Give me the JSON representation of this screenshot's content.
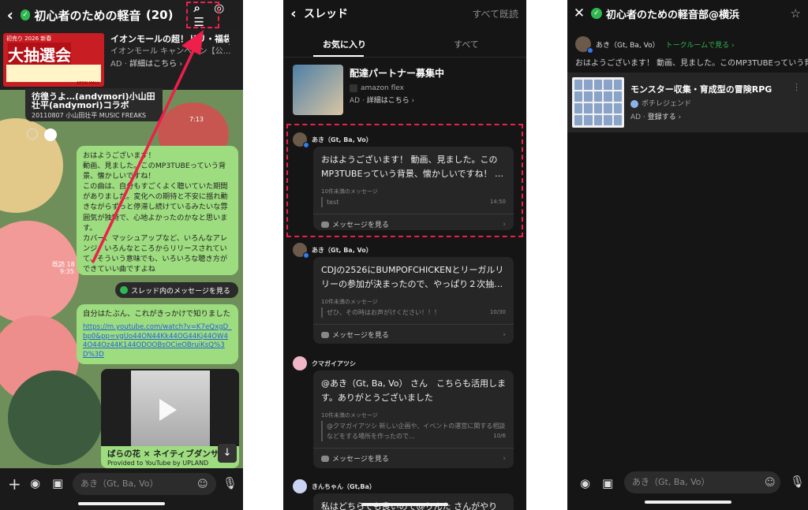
{
  "screen1": {
    "title": "初心者のための軽音",
    "count": "(20)",
    "ad": {
      "banner_top": "初売り 2026 新春",
      "banner_big": "大抽選会",
      "banner_store": "AEON MALL",
      "title": "イオンモールの超！ドリ・福袋",
      "advertiser": "イオンモール キャンペーン【公…",
      "ad_label": "AD",
      "details": "詳細はこちら"
    },
    "quote": {
      "line1": "彷徨うよ…(andymori)小山田",
      "line2": "壮平(andymori)コラボ",
      "line3": "20110807 小山田壮平 MUSIC FREAKS"
    },
    "time1": "7:13",
    "bubble1": "おはようございます！\n動画、見ました。このMP3TUBEっていう背景、懐かしいですね！\nこの曲は、自分もすごくよく聴いていた期間がありました。変化への期待と不安に揺れ動きながらずっと停滞し続けているみたいな雰囲気が独特で、心地よかったのかなと思います。\nカバー、マッシュアップなど、いろんなアレンジ、いろんなところからリリースされていて、そういう意味でも、いろいろな聴き方ができていい曲ですよね",
    "read": "既読 18",
    "time2": "9:35",
    "thread_button": "スレッド内のメッセージを見る",
    "bubble2_text": "自分はたぶん、これがきっかけで知りました",
    "bubble2_link": "https://m.youtube.com/watch?v=K7eQxgD_bp0&pp=ygUo44ON44Kk44OG44Kj44OW44O44Oz44K144ODOOBsOCieOBruiKsQ%3D%3D",
    "video_caption": "ばらの花 × ネイティブダンサー",
    "video_sub": "Provided to YouTube by UPLAND",
    "input_placeholder": "あき（Gt, Ba, Vo）"
  },
  "screen2": {
    "title": "スレッド",
    "mark_all_read": "すべて既読",
    "tabs": [
      "お気に入り",
      "すべて"
    ],
    "ad": {
      "title": "配達パートナー募集中",
      "advertiser": "amazon flex",
      "ad_label": "AD",
      "details": "詳細はこちら"
    },
    "threads": [
      {
        "user": "あき（Gt, Ba, Vo）",
        "message": "おはようございます！ 動画、見ました。このMP3TUBEっていう背景、懐かしいですね！ …",
        "unread": "10件未満のメッセージ",
        "preview": "test",
        "time": "14:50",
        "view": "メッセージを見る"
      },
      {
        "user": "あき（Gt, Ba, Vo）",
        "message": "CDJの2526にBUMPOFCHICKENとリーガルリリーの参加が決まったので、やっぱり２次抽…",
        "unread": "10件未満のメッセージ",
        "preview": "ぜひ、その時はお声がけください！！！",
        "time": "10/30",
        "view": "メッセージを見る"
      },
      {
        "user": "クマガイアツシ",
        "message": "@あき（Gt, Ba, Vo） さん　こちらも活用します。ありがとうございました",
        "unread": "10件未満のメッセージ",
        "preview": "@クマガイアツシ 新しい企画や、イベントの運営に関する相談などをする場所を作ったので…",
        "time": "10/6",
        "view": "メッセージを見る"
      },
      {
        "user": "きんちゃん（Gt,Ba）",
        "message": "私はどちらでも良いので@りんた さんがやり",
        "unread": "",
        "preview": "",
        "time": "",
        "view": ""
      }
    ]
  },
  "screen3": {
    "title": "初心者のための軽音部@横浜",
    "user": "あき（Gt, Ba, Vo）",
    "room_link": "トークルームで見る",
    "message": "おはようございます！ 動画、見ました。このMP3TUBEっていう背",
    "ad": {
      "title": "モンスター収集・育成型の冒険RPG",
      "advertiser": "ポチレジェンド",
      "ad_label": "AD",
      "cta": "登録する"
    },
    "input_placeholder": "あき（Gt, Ba, Vo）"
  },
  "colors": {
    "line_green": "#2fb84f",
    "bubble_green": "#9ddc7f",
    "annotation_red": "#ee1f4a",
    "dark_bg": "#151515"
  }
}
